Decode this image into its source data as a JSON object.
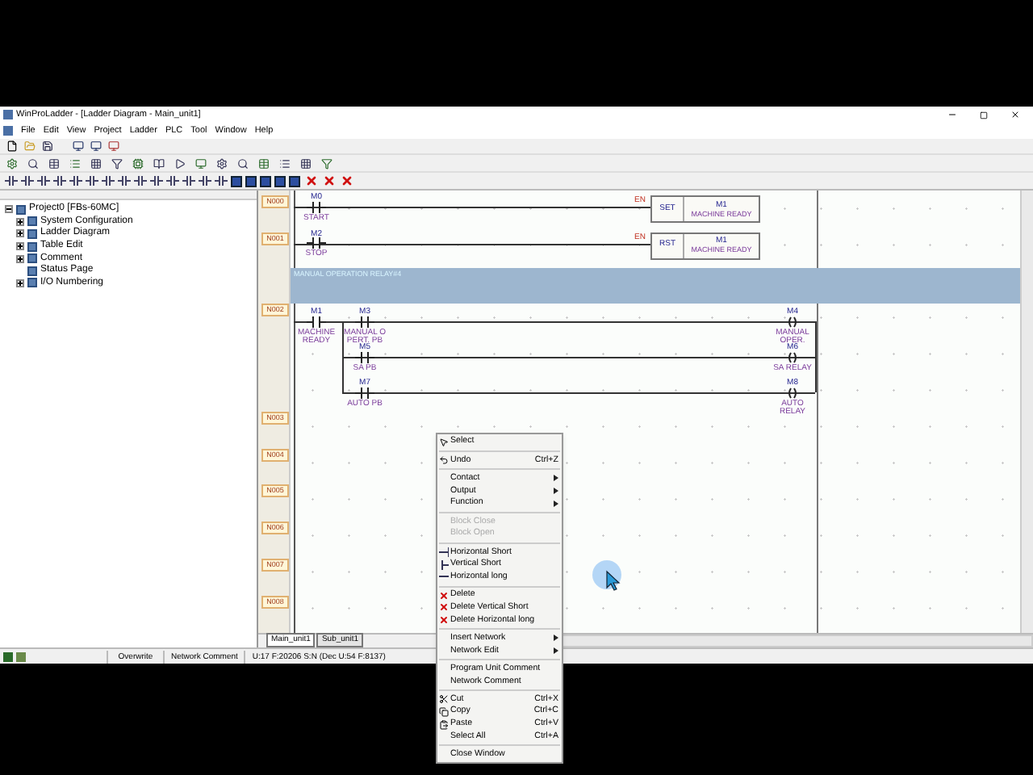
{
  "window": {
    "title": "WinProLadder - [Ladder Diagram - Main_unit1]"
  },
  "menu": [
    "File",
    "Edit",
    "View",
    "Project",
    "Ladder",
    "PLC",
    "Tool",
    "Window",
    "Help"
  ],
  "tree": [
    {
      "label": "Project0 [FBs-60MC]",
      "expanded": true,
      "children": [
        {
          "label": "System Configuration",
          "expanded": false
        },
        {
          "label": "Ladder Diagram",
          "expanded": false
        },
        {
          "label": "Table Edit",
          "expanded": false
        },
        {
          "label": "Comment",
          "expanded": false
        },
        {
          "label": "Status Page"
        },
        {
          "label": "I/O Numbering",
          "expanded": false
        }
      ]
    }
  ],
  "networks": [
    {
      "kind": "box",
      "label": "N000",
      "contact": {
        "address": "M0",
        "comment": [
          "START"
        ]
      },
      "en": "EN",
      "box": {
        "op": "SET",
        "address": "M1",
        "comment": [
          "MACHINE READY"
        ]
      }
    },
    {
      "kind": "box",
      "label": "N001",
      "contact": {
        "address": "M2",
        "comment": [
          "STOP"
        ]
      },
      "en": "EN",
      "box": {
        "op": "RST",
        "address": "M1",
        "comment": [
          "MACHINE READY"
        ]
      }
    },
    {
      "kind": "comment",
      "text": "MANUAL OPERATION RELAY#4"
    },
    {
      "kind": "branch",
      "label": "N002",
      "contact": {
        "address": "M1",
        "comment": [
          "MACHINE",
          "READY"
        ]
      },
      "branches": [
        {
          "contact": {
            "address": "M3",
            "comment": [
              "MANUAL O",
              "PERT. PB"
            ]
          },
          "coil": {
            "address": "M4",
            "comment": [
              "MANUAL",
              "OPER."
            ]
          }
        },
        {
          "contact": {
            "address": "M5",
            "comment": [
              "SA PB"
            ]
          },
          "coil": {
            "address": "M6",
            "comment": [
              "SA RELAY"
            ]
          }
        },
        {
          "contact": {
            "address": "M7",
            "comment": [
              "AUTO PB"
            ]
          },
          "coil": {
            "address": "M8",
            "comment": [
              "AUTO",
              "RELAY"
            ]
          }
        }
      ]
    },
    {
      "kind": "empty",
      "label": "N003"
    },
    {
      "kind": "empty",
      "label": "N004"
    },
    {
      "kind": "empty",
      "label": "N005"
    },
    {
      "kind": "empty",
      "label": "N006"
    },
    {
      "kind": "empty",
      "label": "N007"
    },
    {
      "kind": "empty",
      "label": "N008"
    }
  ],
  "tabs": [
    {
      "label": "Main_unit1",
      "selected": true
    },
    {
      "label": "Sub_unit1",
      "selected": false
    }
  ],
  "status_bar": [
    "Overwrite",
    "Network Comment",
    "U:17 F:20206 S:N (Dec U:54 F:8137)"
  ],
  "context_menu": [
    {
      "kind": "item",
      "label": "Select",
      "disabled": false
    },
    {
      "kind": "separator"
    },
    {
      "kind": "item",
      "label": "Undo",
      "shortcut": "Ctrl+Z",
      "disabled": false
    },
    {
      "kind": "separator"
    },
    {
      "kind": "item",
      "label": "Contact",
      "submenu": true,
      "disabled": false
    },
    {
      "kind": "item",
      "label": "Output",
      "submenu": true,
      "disabled": false
    },
    {
      "kind": "item",
      "label": "Function",
      "submenu": true,
      "disabled": false
    },
    {
      "kind": "separator"
    },
    {
      "kind": "item",
      "label": "Block Close",
      "disabled": true
    },
    {
      "kind": "item",
      "label": "Block Open",
      "disabled": true
    },
    {
      "kind": "separator"
    },
    {
      "kind": "item",
      "label": "Horizontal Short",
      "disabled": false
    },
    {
      "kind": "item",
      "label": "Vertical Short",
      "disabled": false
    },
    {
      "kind": "item",
      "label": "Horizontal long",
      "disabled": false
    },
    {
      "kind": "separator"
    },
    {
      "kind": "item",
      "label": "Delete",
      "disabled": false
    },
    {
      "kind": "item",
      "label": "Delete Vertical Short",
      "disabled": false
    },
    {
      "kind": "item",
      "label": "Delete Horizontal long",
      "disabled": false
    },
    {
      "kind": "separator"
    },
    {
      "kind": "item",
      "label": "Insert Network",
      "submenu": true,
      "disabled": false
    },
    {
      "kind": "item",
      "label": "Network Edit",
      "submenu": true,
      "disabled": false
    },
    {
      "kind": "separator"
    },
    {
      "kind": "item",
      "label": "Program Unit Comment",
      "disabled": false
    },
    {
      "kind": "item",
      "label": "Network Comment",
      "disabled": false
    },
    {
      "kind": "separator"
    },
    {
      "kind": "item",
      "label": "Cut",
      "shortcut": "Ctrl+X",
      "disabled": false
    },
    {
      "kind": "item",
      "label": "Copy",
      "shortcut": "Ctrl+C",
      "disabled": false
    },
    {
      "kind": "item",
      "label": "Paste",
      "shortcut": "Ctrl+V",
      "disabled": false
    },
    {
      "kind": "item",
      "label": "Select All",
      "shortcut": "Ctrl+A",
      "disabled": false
    },
    {
      "kind": "separator"
    },
    {
      "kind": "item",
      "label": "Close Window",
      "disabled": false
    }
  ]
}
